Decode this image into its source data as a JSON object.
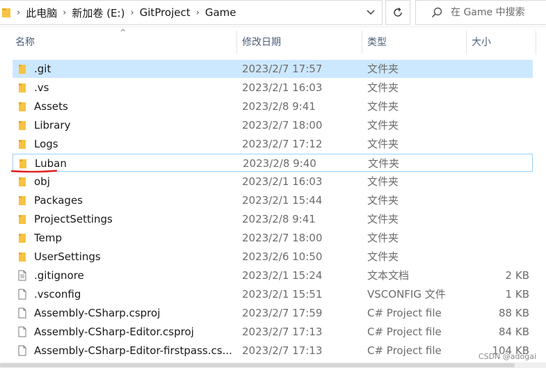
{
  "address_bar": {
    "crumbs": [
      "此电脑",
      "新加卷 (E:)",
      "GitProject",
      "Game"
    ]
  },
  "search": {
    "placeholder": "在 Game 中搜索"
  },
  "columns": {
    "name": "名称",
    "date": "修改日期",
    "type": "类型",
    "size": "大小"
  },
  "files": [
    {
      "name": ".git",
      "date": "2023/2/7 17:57",
      "type": "文件夹",
      "size": "",
      "icon": "folder-icon"
    },
    {
      "name": ".vs",
      "date": "2023/2/1 16:03",
      "type": "文件夹",
      "size": "",
      "icon": "folder-icon"
    },
    {
      "name": "Assets",
      "date": "2023/2/8 9:41",
      "type": "文件夹",
      "size": "",
      "icon": "folder-icon"
    },
    {
      "name": "Library",
      "date": "2023/2/7 18:00",
      "type": "文件夹",
      "size": "",
      "icon": "folder-icon"
    },
    {
      "name": "Logs",
      "date": "2023/2/7 17:12",
      "type": "文件夹",
      "size": "",
      "icon": "folder-icon"
    },
    {
      "name": "Luban",
      "date": "2023/2/8 9:40",
      "type": "文件夹",
      "size": "",
      "icon": "folder-icon"
    },
    {
      "name": "obj",
      "date": "2023/2/1 16:03",
      "type": "文件夹",
      "size": "",
      "icon": "folder-icon"
    },
    {
      "name": "Packages",
      "date": "2023/2/1 15:44",
      "type": "文件夹",
      "size": "",
      "icon": "folder-icon"
    },
    {
      "name": "ProjectSettings",
      "date": "2023/2/8 9:41",
      "type": "文件夹",
      "size": "",
      "icon": "folder-icon"
    },
    {
      "name": "Temp",
      "date": "2023/2/7 18:00",
      "type": "文件夹",
      "size": "",
      "icon": "folder-icon"
    },
    {
      "name": "UserSettings",
      "date": "2023/2/6 10:50",
      "type": "文件夹",
      "size": "",
      "icon": "folder-icon"
    },
    {
      "name": ".gitignore",
      "date": "2023/2/1 15:24",
      "type": "文本文档",
      "size": "2 KB",
      "icon": "text-file-icon"
    },
    {
      "name": ".vsconfig",
      "date": "2023/2/1 15:51",
      "type": "VSCONFIG 文件",
      "size": "1 KB",
      "icon": "file-icon"
    },
    {
      "name": "Assembly-CSharp.csproj",
      "date": "2023/2/7 17:59",
      "type": "C# Project file",
      "size": "88 KB",
      "icon": "file-icon"
    },
    {
      "name": "Assembly-CSharp-Editor.csproj",
      "date": "2023/2/7 17:13",
      "type": "C# Project file",
      "size": "84 KB",
      "icon": "file-icon"
    },
    {
      "name": "Assembly-CSharp-Editor-firstpass.cs...",
      "date": "2023/2/7 17:13",
      "type": "C# Project file",
      "size": "104 KB",
      "icon": "file-icon"
    }
  ],
  "selected_index": 0,
  "focused_index": 5,
  "annotation": {
    "underline_color": "#e02020"
  },
  "watermark": "CSDN @adogai",
  "colors": {
    "folder": "#f6c343",
    "selection": "#cce8ff",
    "header_text": "#4c607a"
  }
}
